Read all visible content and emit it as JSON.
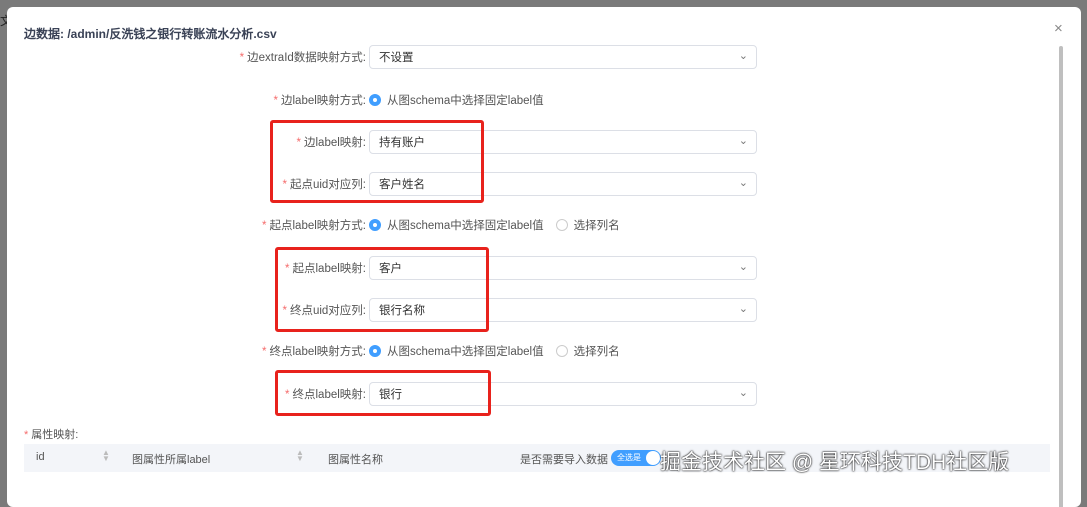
{
  "background_char": "文",
  "dialog": {
    "title": "边数据: /admin/反洗钱之银行转账流水分析.csv",
    "close": "×",
    "req": "*",
    "fields": [
      {
        "label": "边extraId数据映射方式:",
        "value": "不设置"
      },
      {
        "label": "边label映射方式:",
        "options": [
          "从图schema中选择固定label值"
        ]
      },
      {
        "label": "边label映射:",
        "value": "持有账户"
      },
      {
        "label": "起点uid对应列:",
        "value": "客户姓名"
      },
      {
        "label": "起点label映射方式:",
        "options": [
          "从图schema中选择固定label值",
          "选择列名"
        ]
      },
      {
        "label": "起点label映射:",
        "value": "客户"
      },
      {
        "label": "终点uid对应列:",
        "value": "银行名称"
      },
      {
        "label": "终点label映射方式:",
        "options": [
          "从图schema中选择固定label值",
          "选择列名"
        ]
      },
      {
        "label": "终点label映射:",
        "value": "银行"
      }
    ],
    "attr_label": "属性映射:",
    "table": {
      "columns": [
        "id",
        "图属性所属label",
        "图属性名称",
        "是否需要导入数据"
      ],
      "toggle_label": "全选是"
    }
  },
  "watermark": "掘金技术社区 @ 星环科技TDH社区版"
}
